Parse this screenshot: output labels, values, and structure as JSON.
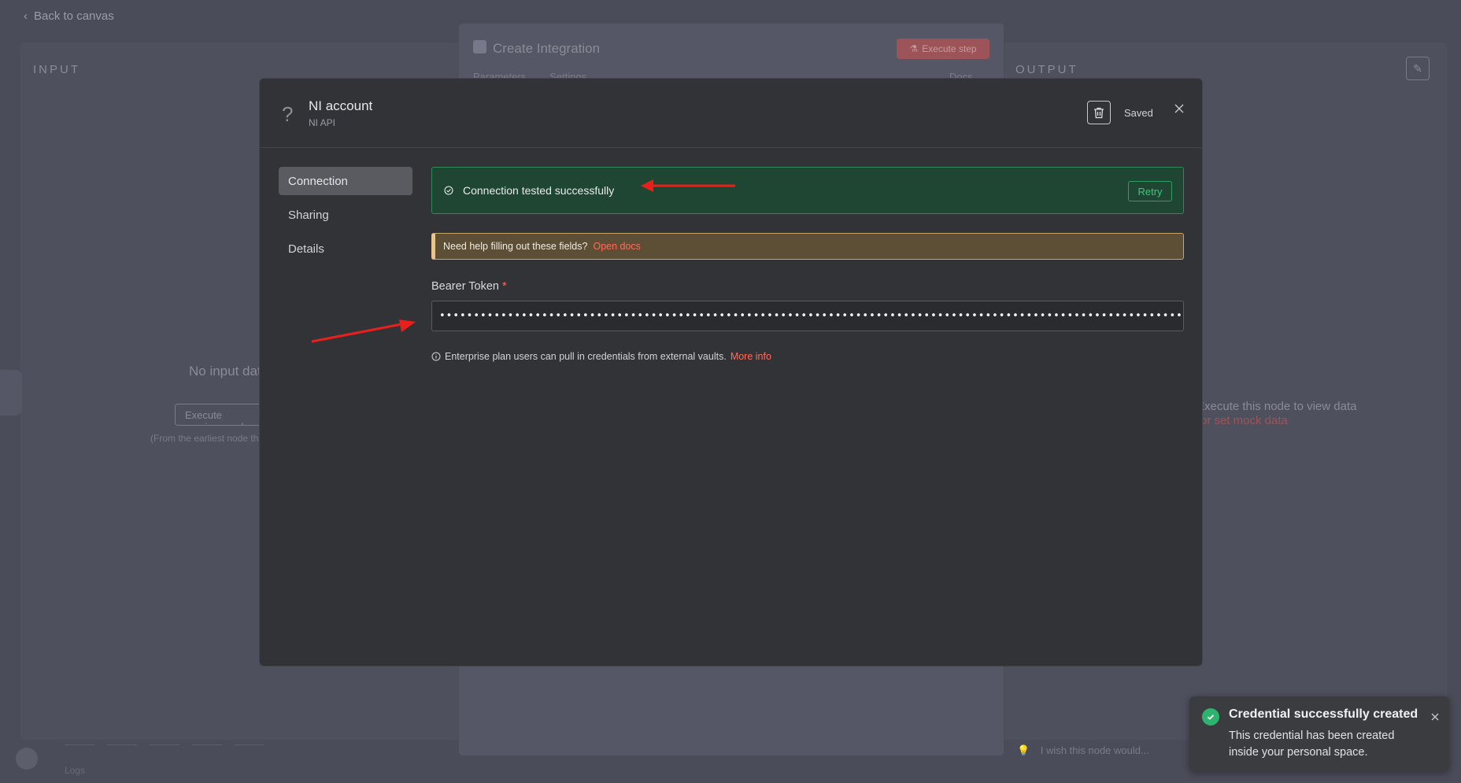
{
  "background": {
    "back_link": "Back to canvas",
    "input_label": "INPUT",
    "output_label": "OUTPUT",
    "node_title": "Create Integration",
    "execute_step": "Execute step",
    "tabs": [
      "Parameters",
      "Settings"
    ],
    "docs": "Docs",
    "no_input": "No input data",
    "execute_previous": "Execute previous nodes",
    "earliest_note": "(From the earliest node that needs it",
    "output_hint": "Execute this node to view data",
    "output_mock": "or set mock data",
    "wish": "I wish this node would...",
    "logs": "Logs"
  },
  "modal": {
    "account_name": "NI account",
    "account_type": "NI API",
    "saved_label": "Saved",
    "nav": [
      {
        "label": "Connection",
        "active": true
      },
      {
        "label": "Sharing",
        "active": false
      },
      {
        "label": "Details",
        "active": false
      }
    ],
    "success_text": "Connection tested successfully",
    "retry_label": "Retry",
    "help_text": "Need help filling out these fields?",
    "help_link": "Open docs",
    "field_label": "Bearer Token",
    "required_marker": "*",
    "token_value": "••••••••••••••••••••••••••••••••••••••••••••••••••••••••••••••••••••••••••••••••••••••••••••••••••••••••••••••••••••••••",
    "vault_note": "Enterprise plan users can pull in credentials from external vaults.",
    "vault_link": "More info"
  },
  "toast": {
    "title": "Credential successfully created",
    "body": "This credential has been created inside your personal space."
  },
  "colors": {
    "accent": "#ff6d5a",
    "success": "#2db36d",
    "annotation_arrow": "#e8201c"
  }
}
